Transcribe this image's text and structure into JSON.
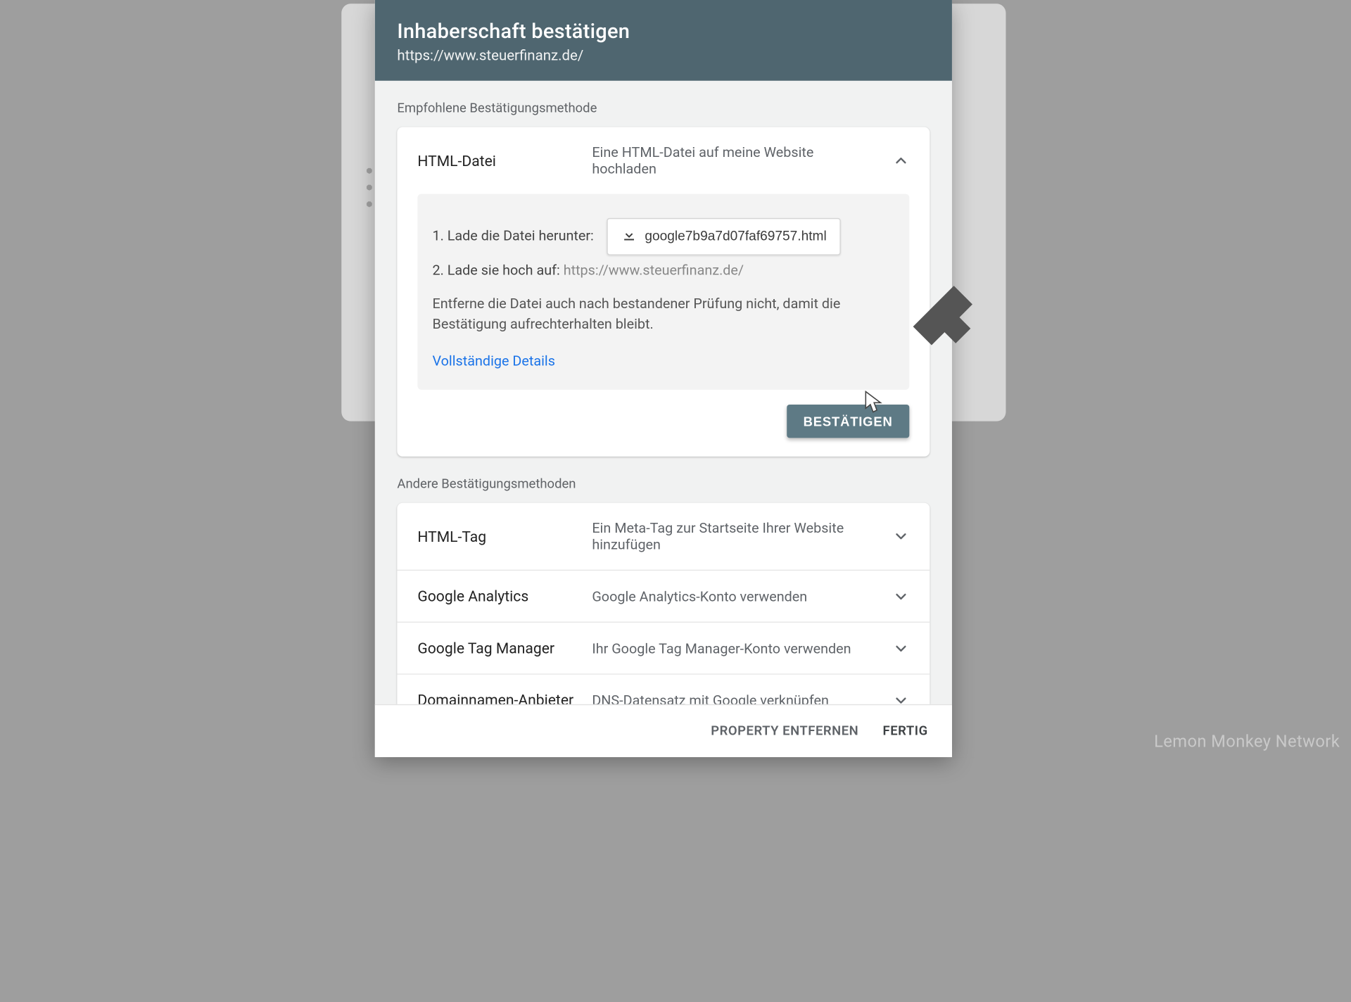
{
  "header": {
    "title": "Inhaberschaft bestätigen",
    "url": "https://www.steuerfinanz.de/"
  },
  "sections": {
    "recommended_label": "Empfohlene Bestätigungsmethode",
    "other_label": "Andere Bestätigungsmethoden"
  },
  "recommended": {
    "title": "HTML-Datei",
    "desc": "Eine HTML-Datei auf meine Website hochladen",
    "step1_label": "1. Lade die Datei herunter:",
    "download_filename": "google7b9a7d07faf69757.html",
    "step2_label": "2. Lade sie hoch auf:",
    "step2_url": "https://www.steuerfinanz.de/",
    "note": "Entferne die Datei auch nach bestandener Prüfung nicht, damit die Bestätigung aufrechterhalten bleibt.",
    "details_link": "Vollständige Details",
    "confirm_button": "BESTÄTIGEN"
  },
  "other_methods": [
    {
      "title": "HTML-Tag",
      "desc": "Ein Meta-Tag zur Startseite Ihrer Website hinzufügen"
    },
    {
      "title": "Google Analytics",
      "desc": "Google Analytics-Konto verwenden"
    },
    {
      "title": "Google Tag Manager",
      "desc": "Ihr Google Tag Manager-Konto verwenden"
    },
    {
      "title": "Domainnamen-Anbieter",
      "desc": "DNS-Datensatz mit Google verknüpfen"
    }
  ],
  "footer": {
    "remove": "PROPERTY ENTFERNEN",
    "done": "FERTIG"
  },
  "watermark": "Lemon Monkey Network"
}
